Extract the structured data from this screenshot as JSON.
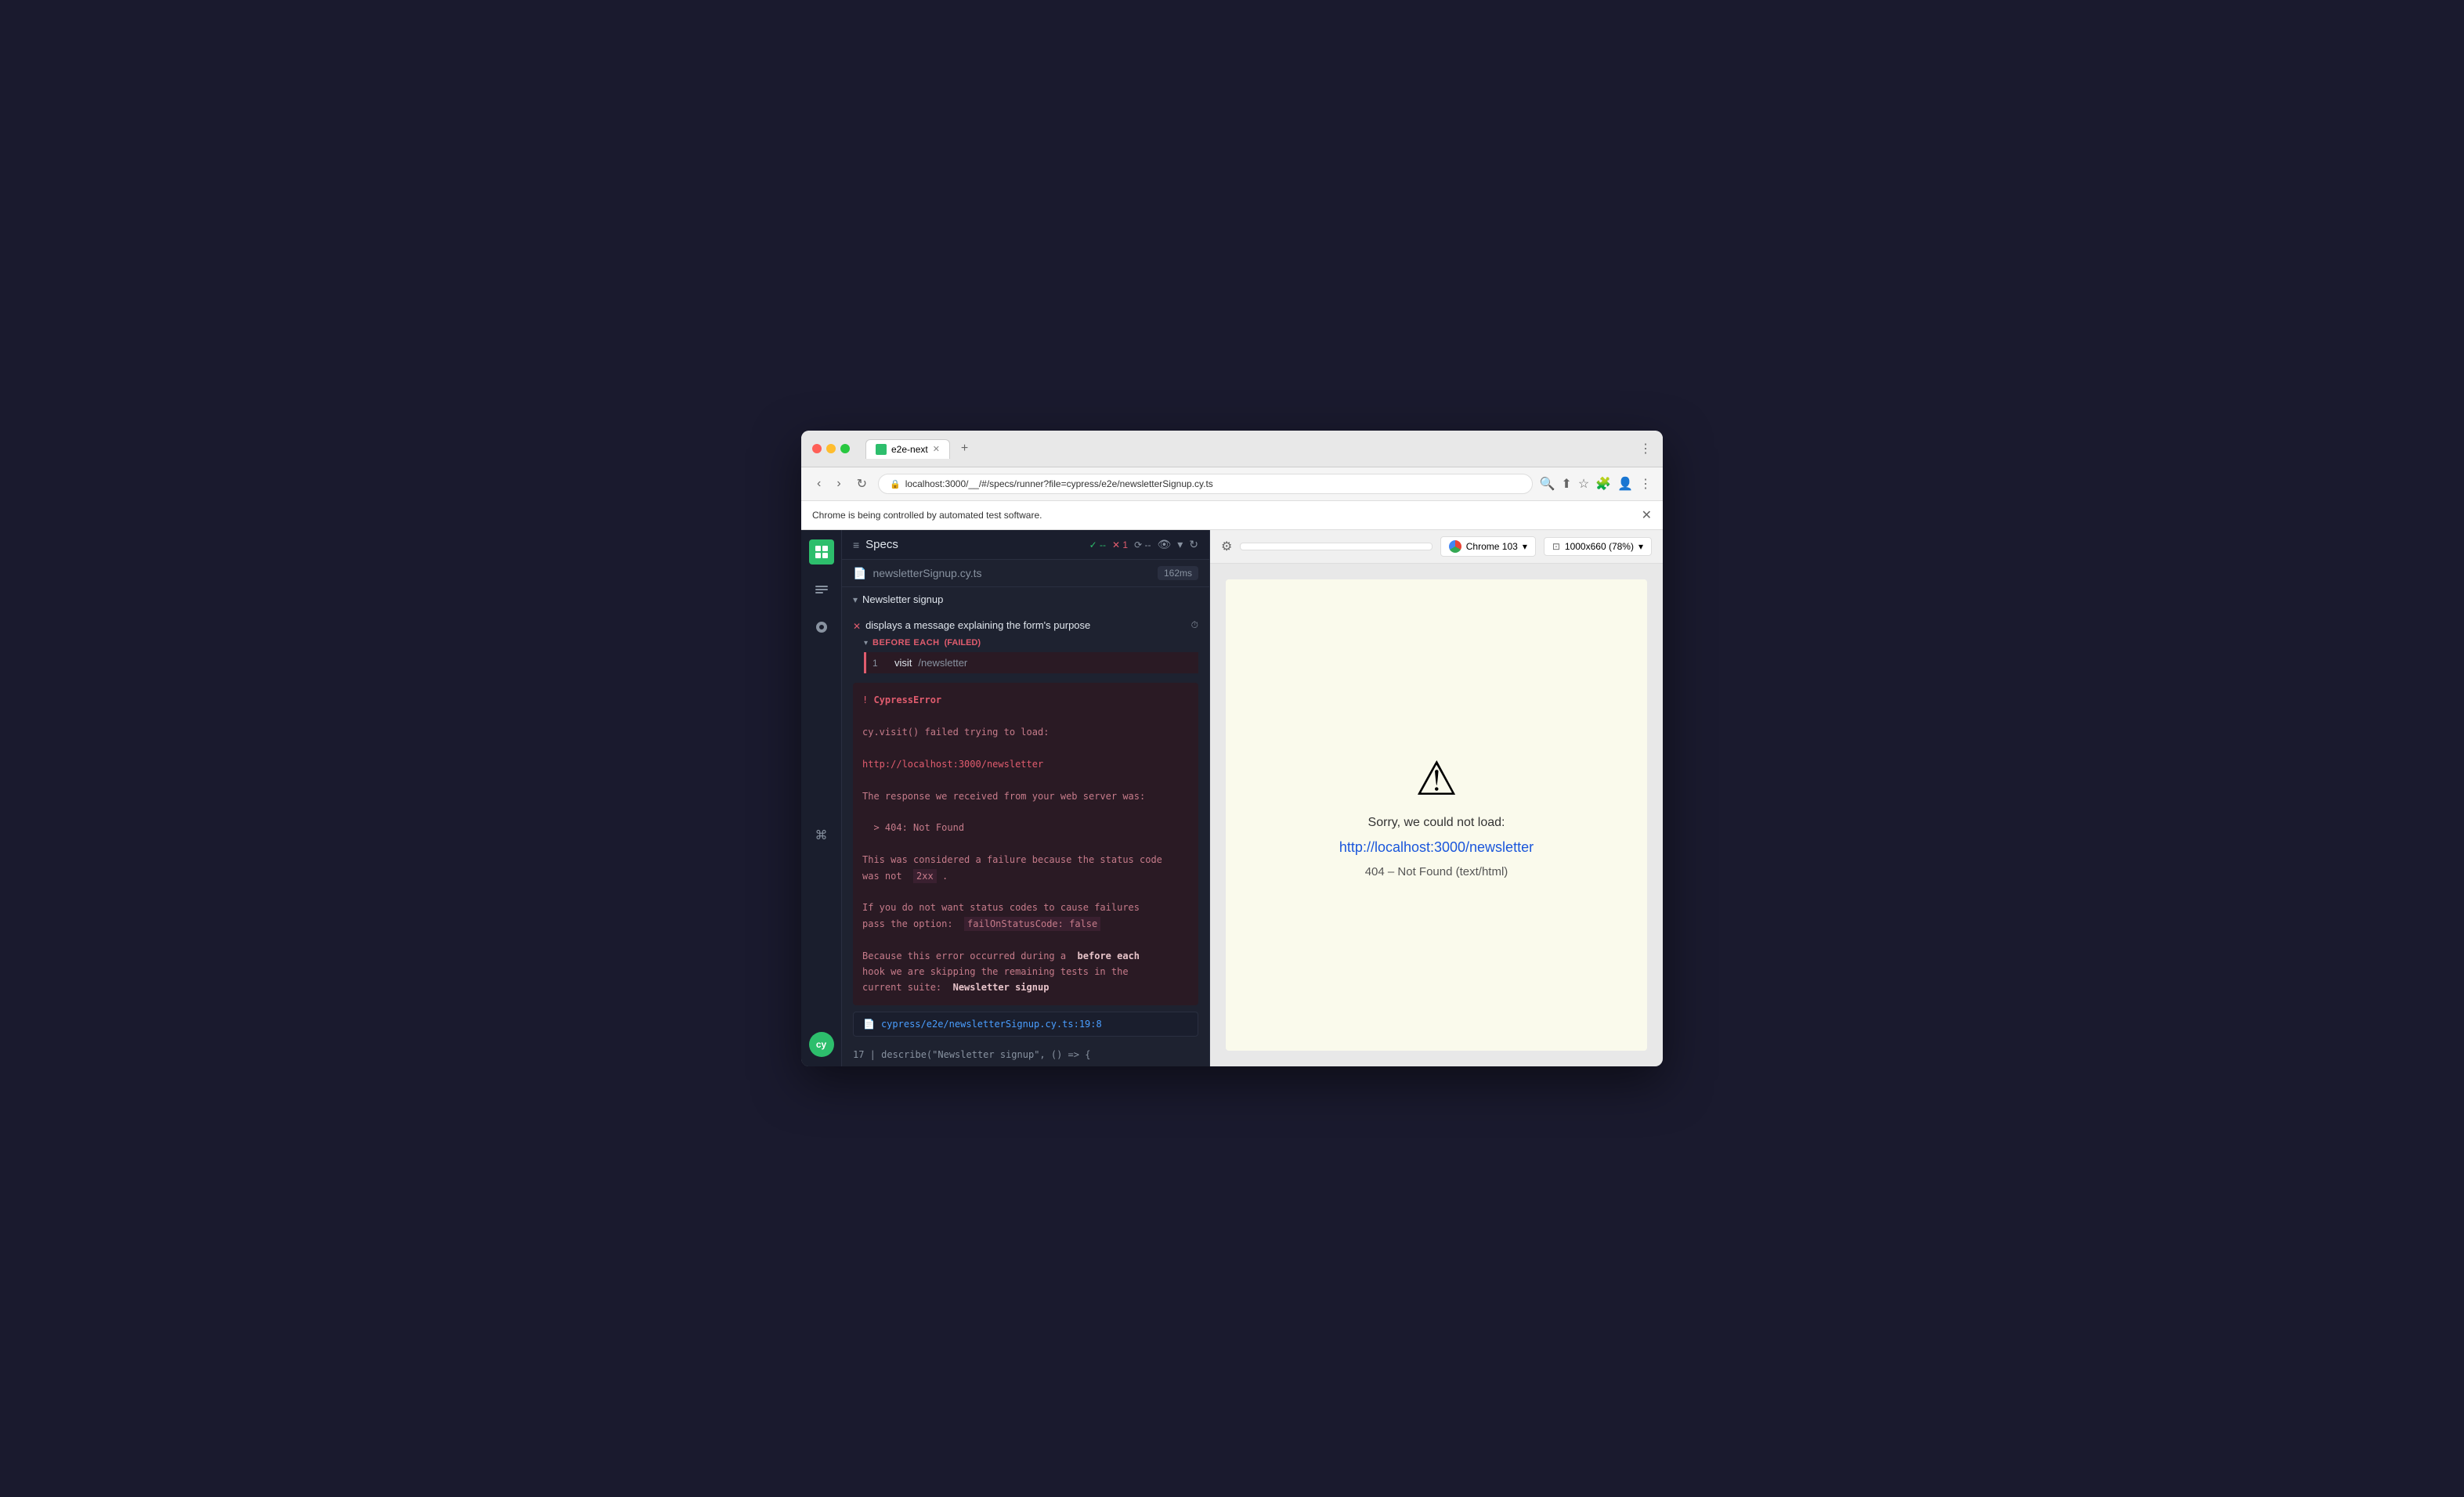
{
  "browser": {
    "title": "e2e-next",
    "url": "localhost:3000/__/#/specs/runner?file=cypress/e2e/newsletterSignup.cy.ts",
    "automation_banner": "Chrome is being controlled by automated test software."
  },
  "specs_panel": {
    "title": "Specs",
    "pass_indicator": "✓ --",
    "fail_count": "✕ 1",
    "pending_indicator": "⟳ --",
    "file": {
      "name": "newsletterSignup",
      "ext": ".cy.ts",
      "time": "162ms"
    },
    "suite": {
      "name": "Newsletter signup",
      "test": {
        "name": "displays a message explaining the form's purpose"
      },
      "before_each": {
        "label": "BEFORE EACH",
        "status": "(FAILED)"
      },
      "step": {
        "number": "1",
        "command": "visit",
        "arg": "/newsletter"
      }
    },
    "error": {
      "exclamation": "!",
      "title": "CypressError",
      "lines": [
        "cy.visit() failed trying to load:",
        "",
        "http://localhost:3000/newsletter",
        "",
        "The response we received from your web server was:",
        "",
        "  > 404: Not Found",
        "",
        "This was considered a failure because the status code",
        "was not  2xx .",
        "",
        "If you do not want status codes to cause failures",
        "pass the option:  failOnStatusCode: false",
        "",
        "Because this error occurred during a  before each",
        "hook we are skipping the remaining tests in the",
        "current suite:  Newsletter signup"
      ]
    },
    "stack_trace": {
      "file": "cypress/e2e/newsletterSignup.cy.ts:19:8",
      "more": "17 | describe(\"Newsletter signup\", () => {"
    }
  },
  "preview": {
    "browser_name": "Chrome 103",
    "viewport": "1000x660 (78%)",
    "error_page": {
      "sorry_text": "Sorry, we could not load:",
      "url": "http://localhost:3000/newsletter",
      "status": "404 – Not Found (text/html)"
    }
  },
  "icons": {
    "file_icon": "☰",
    "gear_icon": "⚙",
    "specs_icon": "≡",
    "list_icon": "≡",
    "settings_icon": "⚙",
    "command_icon": "⌘",
    "cy_logo": "cy",
    "reload_icon": "↻",
    "eye_icon": "👁",
    "chevron_down": "▾",
    "chevron_right": "▸",
    "viewport_icon": "⊡"
  }
}
